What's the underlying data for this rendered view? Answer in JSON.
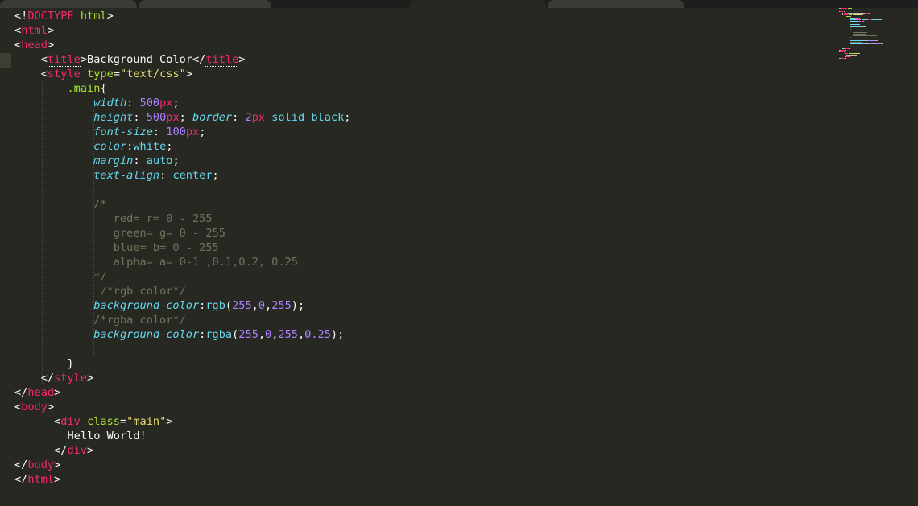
{
  "tabs": [
    {
      "label": "...",
      "active": false
    },
    {
      "label": "...",
      "active": false
    },
    {
      "label": "...",
      "active": true
    },
    {
      "label": "...",
      "active": false
    }
  ],
  "code_lines": [
    [
      [
        "t-punct",
        "<!"
      ],
      [
        "t-doctype",
        "DOCTYPE"
      ],
      [
        "t-punct",
        " "
      ],
      [
        "t-attr",
        "html"
      ],
      [
        "t-punct",
        ">"
      ]
    ],
    [
      [
        "t-punct",
        "<"
      ],
      [
        "t-tag",
        "html"
      ],
      [
        "t-punct",
        ">"
      ]
    ],
    [
      [
        "t-punct",
        "<"
      ],
      [
        "t-tag",
        "head"
      ],
      [
        "t-punct",
        ">"
      ]
    ],
    [
      [
        "t-punct",
        "    <"
      ],
      [
        "t-tag u",
        "title"
      ],
      [
        "t-punct",
        ">"
      ],
      [
        "t-text",
        "Background Color"
      ],
      [
        "caret",
        ""
      ],
      [
        "t-punct",
        "</"
      ],
      [
        "t-tag u",
        "title"
      ],
      [
        "t-punct",
        ">"
      ]
    ],
    [
      [
        "t-punct",
        "    <"
      ],
      [
        "t-tag",
        "style"
      ],
      [
        "t-punct",
        " "
      ],
      [
        "t-attr",
        "type"
      ],
      [
        "t-punct",
        "="
      ],
      [
        "t-str",
        "\"text/css\""
      ],
      [
        "t-punct",
        ">"
      ]
    ],
    [
      [
        "t-punct",
        "        "
      ],
      [
        "t-sel",
        ".main"
      ],
      [
        "t-punct",
        "{"
      ]
    ],
    [
      [
        "t-punct",
        "            "
      ],
      [
        "t-prop",
        "width"
      ],
      [
        "t-punct",
        ": "
      ],
      [
        "t-num",
        "500"
      ],
      [
        "t-unit",
        "px"
      ],
      [
        "t-punct",
        ";"
      ]
    ],
    [
      [
        "t-punct",
        "            "
      ],
      [
        "t-prop",
        "height"
      ],
      [
        "t-punct",
        ": "
      ],
      [
        "t-num",
        "500"
      ],
      [
        "t-unit",
        "px"
      ],
      [
        "t-punct",
        "; "
      ],
      [
        "t-prop",
        "border"
      ],
      [
        "t-punct",
        ": "
      ],
      [
        "t-num",
        "2"
      ],
      [
        "t-unit",
        "px"
      ],
      [
        "t-punct",
        " "
      ],
      [
        "t-val",
        "solid black"
      ],
      [
        "t-punct",
        ";"
      ]
    ],
    [
      [
        "t-punct",
        "            "
      ],
      [
        "t-prop",
        "font-size"
      ],
      [
        "t-punct",
        ": "
      ],
      [
        "t-num",
        "100"
      ],
      [
        "t-unit",
        "px"
      ],
      [
        "t-punct",
        ";"
      ]
    ],
    [
      [
        "t-punct",
        "            "
      ],
      [
        "t-prop",
        "color"
      ],
      [
        "t-punct",
        ":"
      ],
      [
        "t-val",
        "white"
      ],
      [
        "t-punct",
        ";"
      ]
    ],
    [
      [
        "t-punct",
        "            "
      ],
      [
        "t-prop",
        "margin"
      ],
      [
        "t-punct",
        ": "
      ],
      [
        "t-val",
        "auto"
      ],
      [
        "t-punct",
        ";"
      ]
    ],
    [
      [
        "t-punct",
        "            "
      ],
      [
        "t-prop",
        "text-align"
      ],
      [
        "t-punct",
        ": "
      ],
      [
        "t-val",
        "center"
      ],
      [
        "t-punct",
        ";"
      ]
    ],
    [
      [
        "t-punct",
        ""
      ]
    ],
    [
      [
        "t-punct",
        "            "
      ],
      [
        "t-comment",
        "/*"
      ]
    ],
    [
      [
        "t-punct",
        "               "
      ],
      [
        "t-comment",
        "red= r= 0 - 255"
      ]
    ],
    [
      [
        "t-punct",
        "               "
      ],
      [
        "t-comment",
        "green= g= 0 - 255"
      ]
    ],
    [
      [
        "t-punct",
        "               "
      ],
      [
        "t-comment",
        "blue= b= 0 - 255"
      ]
    ],
    [
      [
        "t-punct",
        "               "
      ],
      [
        "t-comment",
        "alpha= a= 0-1 ,0.1,0.2, 0.25"
      ]
    ],
    [
      [
        "t-punct",
        "            "
      ],
      [
        "t-comment",
        "*/"
      ]
    ],
    [
      [
        "t-punct",
        "             "
      ],
      [
        "t-comment",
        "/*rgb color*/"
      ]
    ],
    [
      [
        "t-punct",
        "            "
      ],
      [
        "t-prop",
        "background-color"
      ],
      [
        "t-punct",
        ":"
      ],
      [
        "t-val",
        "rgb"
      ],
      [
        "t-punct",
        "("
      ],
      [
        "t-num",
        "255"
      ],
      [
        "t-punct",
        ","
      ],
      [
        "t-num",
        "0"
      ],
      [
        "t-punct",
        ","
      ],
      [
        "t-num",
        "255"
      ],
      [
        "t-punct",
        ");"
      ]
    ],
    [
      [
        "t-punct",
        "            "
      ],
      [
        "t-comment",
        "/*rgba color*/"
      ]
    ],
    [
      [
        "t-punct",
        "            "
      ],
      [
        "t-prop",
        "background-color"
      ],
      [
        "t-punct",
        ":"
      ],
      [
        "t-val",
        "rgba"
      ],
      [
        "t-punct",
        "("
      ],
      [
        "t-num",
        "255"
      ],
      [
        "t-punct",
        ","
      ],
      [
        "t-num",
        "0"
      ],
      [
        "t-punct",
        ","
      ],
      [
        "t-num",
        "255"
      ],
      [
        "t-punct",
        ","
      ],
      [
        "t-num",
        "0.25"
      ],
      [
        "t-punct",
        ");"
      ]
    ],
    [
      [
        "t-punct",
        ""
      ]
    ],
    [
      [
        "t-punct",
        "        }"
      ]
    ],
    [
      [
        "t-punct",
        "    </"
      ],
      [
        "t-tag",
        "style"
      ],
      [
        "t-punct",
        ">"
      ]
    ],
    [
      [
        "t-punct",
        "</"
      ],
      [
        "t-tag",
        "head"
      ],
      [
        "t-punct",
        ">"
      ]
    ],
    [
      [
        "t-punct",
        "<"
      ],
      [
        "t-tag",
        "body"
      ],
      [
        "t-punct",
        ">"
      ]
    ],
    [
      [
        "t-punct",
        "      <"
      ],
      [
        "t-tag",
        "div"
      ],
      [
        "t-punct",
        " "
      ],
      [
        "t-attr",
        "class"
      ],
      [
        "t-punct",
        "="
      ],
      [
        "t-str",
        "\"main\""
      ],
      [
        "t-punct",
        ">"
      ]
    ],
    [
      [
        "t-punct",
        "        "
      ],
      [
        "t-text",
        "Hello World!"
      ]
    ],
    [
      [
        "t-punct",
        "      </"
      ],
      [
        "t-tag",
        "div"
      ],
      [
        "t-punct",
        ">"
      ]
    ],
    [
      [
        "t-punct",
        "</"
      ],
      [
        "t-tag",
        "body"
      ],
      [
        "t-punct",
        ">"
      ]
    ],
    [
      [
        "t-punct",
        "</"
      ],
      [
        "t-tag",
        "html"
      ],
      [
        "t-punct",
        ">"
      ]
    ]
  ],
  "colors": {
    "background": "#272822",
    "tag": "#f92672",
    "attr": "#a6e22e",
    "string": "#e6db74",
    "property": "#66d9ef",
    "number": "#ae81ff",
    "comment": "#75715e",
    "text": "#f8f8f2"
  }
}
